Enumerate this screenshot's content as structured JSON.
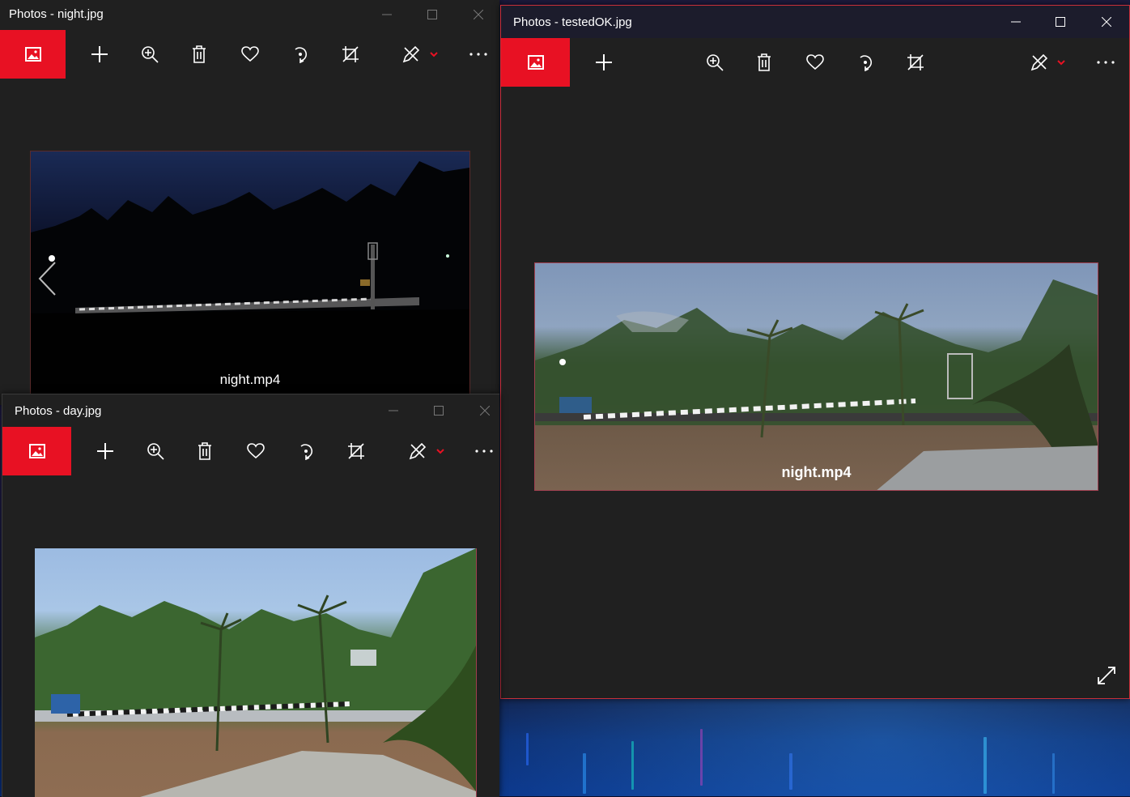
{
  "colors": {
    "accent": "#e81123",
    "window_bg": "#202020",
    "toolbar_icon": "#ffffff"
  },
  "windows": {
    "night": {
      "title": "Photos - night.jpg",
      "photo_caption": "night.mp4"
    },
    "day": {
      "title": "Photos - day.jpg"
    },
    "tested": {
      "title": "Photos - testedOK.jpg",
      "photo_caption": "night.mp4"
    }
  },
  "toolbar_icons": [
    "photos-app-icon",
    "add-icon",
    "zoom-in-icon",
    "delete-icon",
    "favorite-heart-icon",
    "rotate-icon",
    "crop-icon",
    "edit-draw-icon",
    "chevron-down-icon",
    "more-options-icon"
  ],
  "caption_icons": [
    "minimize-icon",
    "maximize-icon",
    "close-icon"
  ],
  "expand_icon": "fullscreen-expand-icon",
  "nav_icon": "previous-photo-chevron-icon"
}
